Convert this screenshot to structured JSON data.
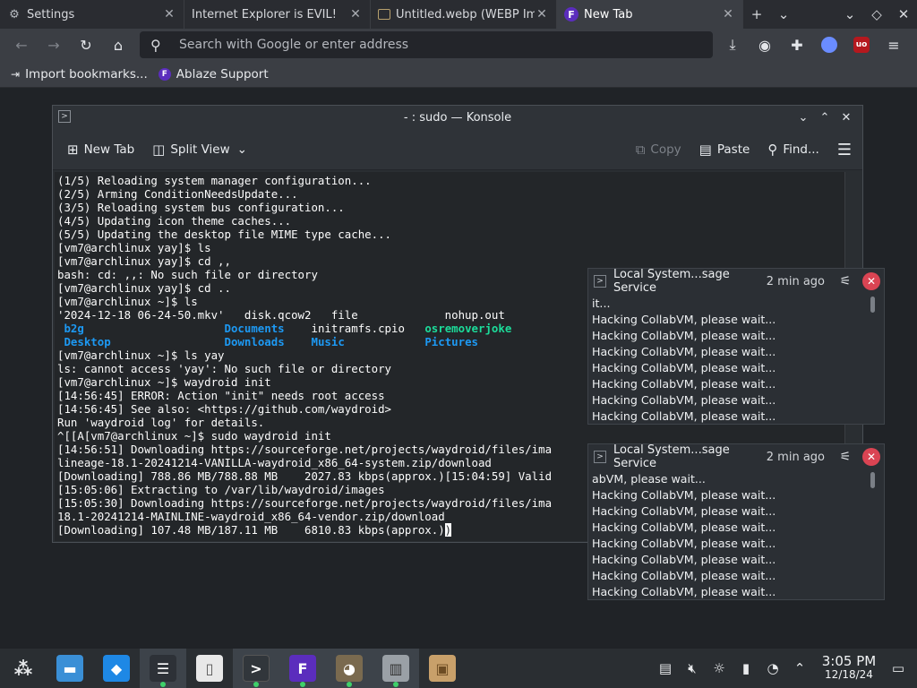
{
  "browser": {
    "tabs": [
      {
        "title": "Settings",
        "icon": "gear-icon"
      },
      {
        "title": "Internet Explorer is EVIL!",
        "icon": "none"
      },
      {
        "title": "Untitled.webp (WEBP Im",
        "icon": "image-icon"
      },
      {
        "title": "New Tab",
        "icon": "ablaze-icon"
      }
    ],
    "address_placeholder": "Search with Google or enter address",
    "bookmarks": [
      "Import bookmarks...",
      "Ablaze Support"
    ]
  },
  "konsole": {
    "title": "- : sudo — Konsole",
    "toolbar": {
      "new_tab": "New Tab",
      "split_view": "Split View",
      "copy": "Copy",
      "paste": "Paste",
      "find": "Find..."
    },
    "lines": [
      "(1/5) Reloading system manager configuration...",
      "(2/5) Arming ConditionNeedsUpdate...",
      "(3/5) Reloading system bus configuration...",
      "(4/5) Updating icon theme caches...",
      "(5/5) Updating the desktop file MIME type cache...",
      "[vm7@archlinux yay]$ ls",
      "[vm7@archlinux yay]$ cd ,,",
      "bash: cd: ,,: No such file or directory",
      "[vm7@archlinux yay]$ cd ..",
      "[vm7@archlinux ~]$ ls",
      "'2024-12-18 06-24-50.mkv'   disk.qcow2   file             nohup.out",
      "",
      "",
      "[vm7@archlinux ~]$ ls yay",
      "ls: cannot access 'yay': No such file or directory",
      "[vm7@archlinux ~]$ waydroid init",
      "[14:56:45] ERROR: Action \"init\" needs root access",
      "[14:56:45] See also: <https://github.com/waydroid>",
      "Run 'waydroid log' for details.",
      "^[[A[vm7@archlinux ~]$ sudo waydroid init",
      "[14:56:51] Downloading https://sourceforge.net/projects/waydroid/files/ima",
      "lineage-18.1-20241214-VANILLA-waydroid_x86_64-system.zip/download",
      "[Downloading] 788.86 MB/788.88 MB    2027.83 kbps(approx.)[15:04:59] Valid",
      "[15:05:06] Extracting to /var/lib/waydroid/images",
      "[15:05:30] Downloading https://sourceforge.net/projects/waydroid/files/ima",
      "18.1-20241214-MAINLINE-waydroid_x86_64-vendor.zip/download",
      "[Downloading] 107.48 MB/187.11 MB    6810.83 kbps(approx.)"
    ],
    "ls_row2": {
      "a": " b2g",
      "b": "Documents",
      "c": "initramfs.cpio",
      "d": "osremoverjoke"
    },
    "ls_row3": {
      "a": " Desktop",
      "b": "Downloads",
      "c": "Music",
      "d": "Pictures"
    }
  },
  "notifications": [
    {
      "source": "Local System...sage Service",
      "time": "2 min ago",
      "lines": [
        "it...",
        "Hacking CollabVM, please wait...",
        "Hacking CollabVM, please wait...",
        "Hacking CollabVM, please wait...",
        "Hacking CollabVM, please wait...",
        "Hacking CollabVM, please wait...",
        "Hacking CollabVM, please wait...",
        "Hacking CollabVM, please wait..."
      ]
    },
    {
      "source": "Local System...sage Service",
      "time": "2 min ago",
      "lines": [
        "abVM, please wait...",
        "Hacking CollabVM, please wait...",
        "Hacking CollabVM, please wait...",
        "Hacking CollabVM, please wait...",
        "Hacking CollabVM, please wait...",
        "Hacking CollabVM, please wait...",
        "Hacking CollabVM, please wait...",
        "Hacking CollabVM, please wait..."
      ]
    }
  ],
  "taskbar": {
    "time": "3:05 PM",
    "date": "12/18/24"
  },
  "colors": {
    "accent": "#1d99f3",
    "terminal_green": "#1cdc9a",
    "close_red": "#da4453"
  }
}
